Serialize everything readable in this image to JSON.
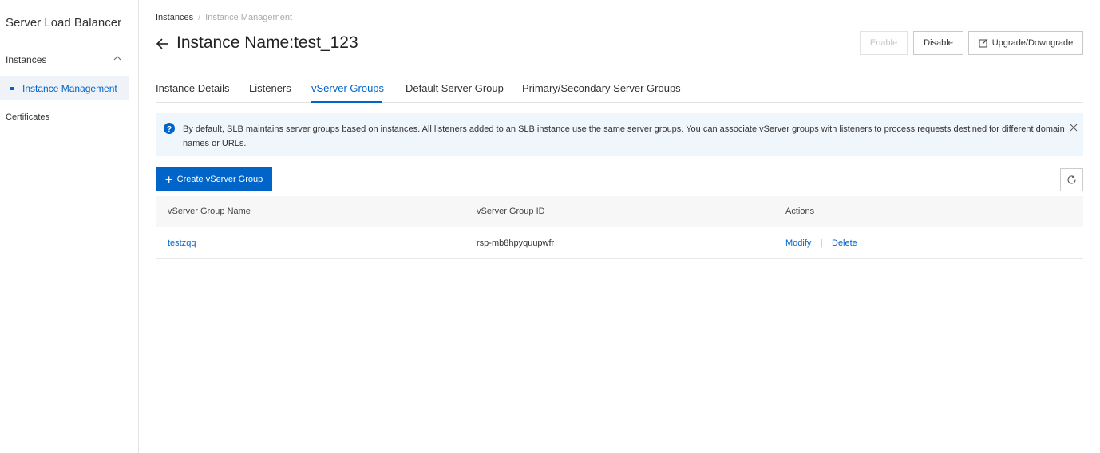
{
  "sidebar": {
    "title": "Server Load Balancer",
    "group_label": "Instances",
    "active_item": "Instance Management",
    "certificates": "Certificates"
  },
  "breadcrumb": {
    "root": "Instances",
    "separator": "/",
    "current": "Instance Management"
  },
  "header": {
    "title": "Instance Name:test_123",
    "enable_label": "Enable",
    "disable_label": "Disable",
    "upgrade_label": "Upgrade/Downgrade"
  },
  "tabs": [
    {
      "label": "Instance Details"
    },
    {
      "label": "Listeners"
    },
    {
      "label": "vServer Groups"
    },
    {
      "label": "Default Server Group"
    },
    {
      "label": "Primary/Secondary Server Groups"
    }
  ],
  "notice": {
    "text": "By default, SLB maintains server groups based on instances. All listeners added to an SLB instance use the same server groups. You can associate vServer groups with listeners to process requests destined for different domain names or URLs."
  },
  "toolbar": {
    "create_label": "Create vServer Group"
  },
  "table": {
    "columns": [
      "vServer Group Name",
      "vServer Group ID",
      "Actions"
    ],
    "rows": [
      {
        "name": "testzqq",
        "id": "rsp-mb8hpyquupwfr",
        "modify": "Modify",
        "delete": "Delete"
      }
    ]
  },
  "colors": {
    "accent": "#0064c8",
    "notice_bg": "#eff6fc",
    "active_nav_bg": "#eff3f8"
  },
  "icons": {
    "back": "arrow-left-icon",
    "chevron": "chevron-up-icon",
    "help": "question-circle-icon",
    "close": "close-icon",
    "edit": "edit-icon",
    "refresh": "refresh-icon",
    "plus": "plus-icon"
  }
}
